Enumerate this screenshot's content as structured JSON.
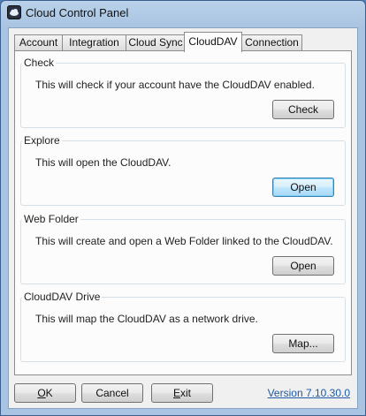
{
  "window": {
    "title": "Cloud Control Panel",
    "icon": "cloud-app-icon"
  },
  "tabs": [
    {
      "label": "Account",
      "active": false
    },
    {
      "label": "Integration",
      "active": false
    },
    {
      "label": "Cloud Sync",
      "active": false
    },
    {
      "label": "CloudDAV",
      "active": true
    },
    {
      "label": "Connection",
      "active": false
    }
  ],
  "groups": {
    "check": {
      "title": "Check",
      "description": "This will check if your account have the CloudDAV enabled.",
      "button": "Check"
    },
    "explore": {
      "title": "Explore",
      "description": "This will open the CloudDAV.",
      "button": "Open"
    },
    "web_folder": {
      "title": "Web Folder",
      "description": "This will create and open a Web Folder linked to the CloudDAV.",
      "button": "Open"
    },
    "drive": {
      "title": "CloudDAV Drive",
      "description": "This will map the CloudDAV as a network drive.",
      "button": "Map..."
    }
  },
  "footer": {
    "ok_rest": "K",
    "ok_mnemonic": "O",
    "cancel": "Cancel",
    "exit_mnemonic": "E",
    "exit_rest": "xit",
    "version": "Version 7.10.30.0"
  },
  "colors": {
    "link": "#1c5aa8",
    "default_button_border": "#3c7fb1",
    "titlebar": "#a9c4e2"
  }
}
